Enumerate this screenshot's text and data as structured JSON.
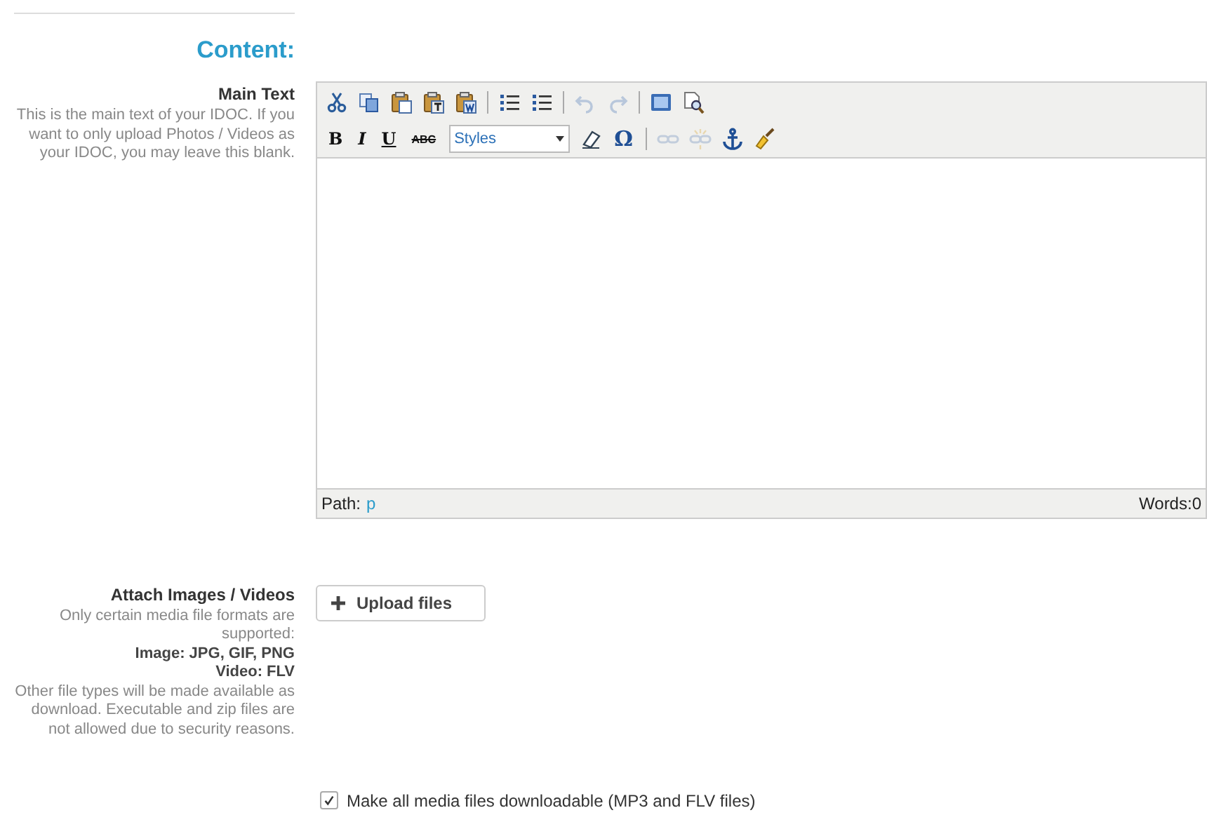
{
  "section_title": "Content:",
  "main_text": {
    "label": "Main Text",
    "help": "This is the main text of your IDOC. If you want to only upload Photos / Videos as your IDOC, you may leave this blank."
  },
  "editor": {
    "toolbar_rows": [
      [
        {
          "kind": "cut",
          "disabled": false
        },
        {
          "kind": "copy",
          "disabled": false
        },
        {
          "kind": "paste",
          "disabled": false
        },
        {
          "kind": "paste-text",
          "disabled": false
        },
        {
          "kind": "paste-word",
          "disabled": false
        },
        {
          "kind": "separator"
        },
        {
          "kind": "bullets",
          "disabled": false
        },
        {
          "kind": "numbers",
          "disabled": false
        },
        {
          "kind": "separator"
        },
        {
          "kind": "undo",
          "disabled": true
        },
        {
          "kind": "redo",
          "disabled": true
        },
        {
          "kind": "separator"
        },
        {
          "kind": "fullscreen",
          "disabled": false
        },
        {
          "kind": "preview",
          "disabled": false
        }
      ],
      [
        {
          "kind": "bold",
          "label": "B",
          "disabled": false
        },
        {
          "kind": "italic",
          "label": "I",
          "disabled": false
        },
        {
          "kind": "underline",
          "label": "U",
          "disabled": false
        },
        {
          "kind": "strike",
          "label": "ABC",
          "disabled": false
        },
        {
          "kind": "styles",
          "label": "Styles"
        },
        {
          "kind": "eraser",
          "disabled": false
        },
        {
          "kind": "symbol",
          "label": "Ω",
          "disabled": false
        },
        {
          "kind": "separator"
        },
        {
          "kind": "link",
          "disabled": true
        },
        {
          "kind": "unlink",
          "disabled": true
        },
        {
          "kind": "anchor",
          "disabled": false
        },
        {
          "kind": "cleanup",
          "disabled": false
        }
      ]
    ],
    "path_label": "Path:",
    "path_value": "p",
    "word_count": "Words:0"
  },
  "attach": {
    "label": "Attach Images / Videos",
    "help_lines": [
      {
        "text": "Only certain media file formats are supported:",
        "bold": false
      },
      {
        "text": "Image: JPG, GIF, PNG",
        "bold": true
      },
      {
        "text": "Video: FLV",
        "bold": true
      },
      {
        "text": "Other file types will be made available as download. Executable and zip files are not allowed due to security reasons.",
        "bold": false
      }
    ],
    "button": "Upload files"
  },
  "downloadable": {
    "label": "Make all media files downloadable (MP3 and FLV files)",
    "checked": true
  }
}
